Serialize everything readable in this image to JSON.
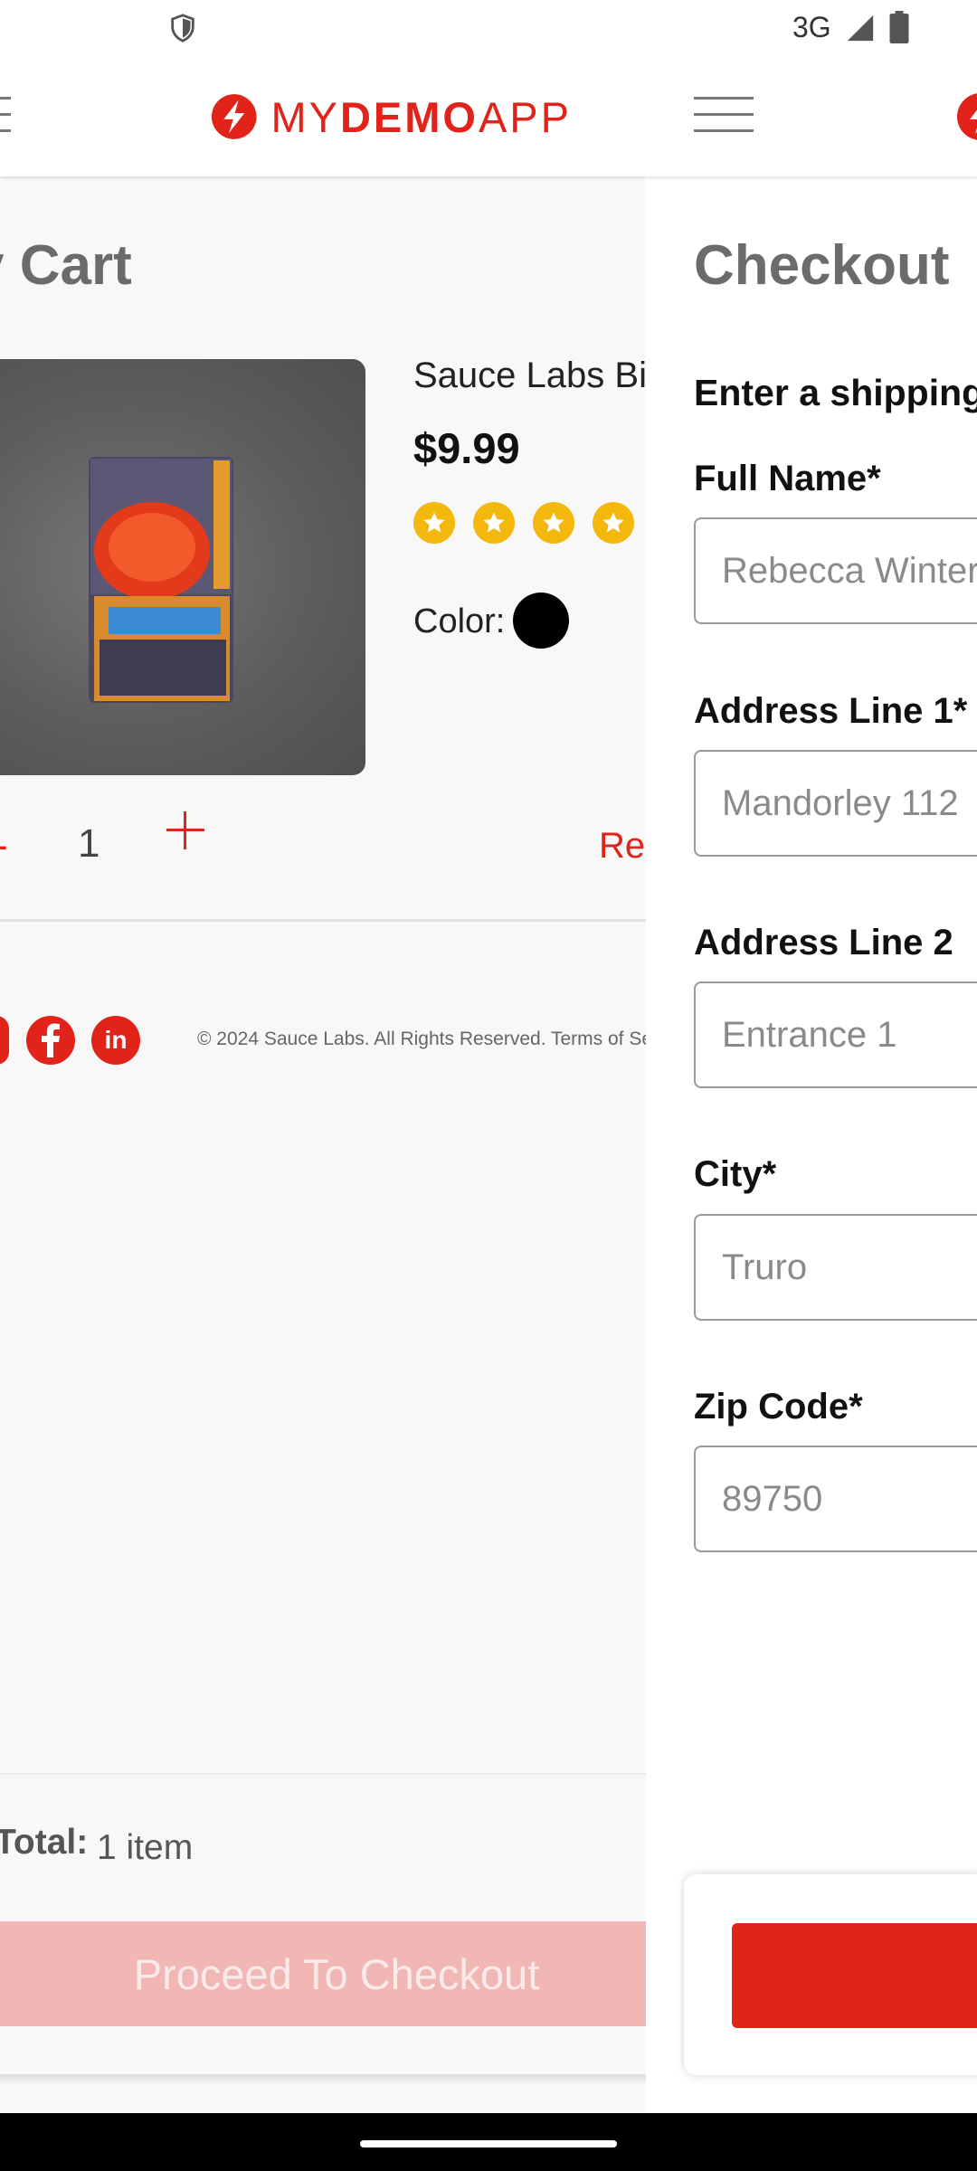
{
  "status_bar": {
    "network": "3G",
    "icons": [
      "shield-icon",
      "signal-icon",
      "battery-icon"
    ]
  },
  "cart": {
    "logo": {
      "prefix": "MY",
      "bold": "DEMO",
      "suffix": "APP"
    },
    "title": "y Cart",
    "product": {
      "name": "Sauce Labs Bi",
      "price": "$9.99",
      "rating": 4,
      "color_label": "Color:",
      "color_value": "#000000"
    },
    "quantity": {
      "minus": "-",
      "value": "1"
    },
    "remove_label": "Re",
    "footer_text": "© 2024 Sauce Labs. All Rights Reserved. Terms of Se",
    "total_label": "Total:",
    "total_items": "1 item",
    "checkout_button": "Proceed To Checkout"
  },
  "checkout": {
    "title": "Checkout",
    "subtitle": "Enter a shipping",
    "fields": {
      "full_name": {
        "label": "Full Name*",
        "placeholder": "Rebecca Winter"
      },
      "address1": {
        "label": "Address Line 1*",
        "placeholder": "Mandorley 112"
      },
      "address2": {
        "label": "Address Line 2",
        "placeholder": "Entrance 1"
      },
      "city": {
        "label": "City*",
        "placeholder": "Truro"
      },
      "zip": {
        "label": "Zip Code*",
        "placeholder": "89750"
      }
    }
  },
  "colors": {
    "brand_red": "#e2231a",
    "star_yellow": "#f4b70b",
    "disabled_button": "#f0b7b5"
  }
}
